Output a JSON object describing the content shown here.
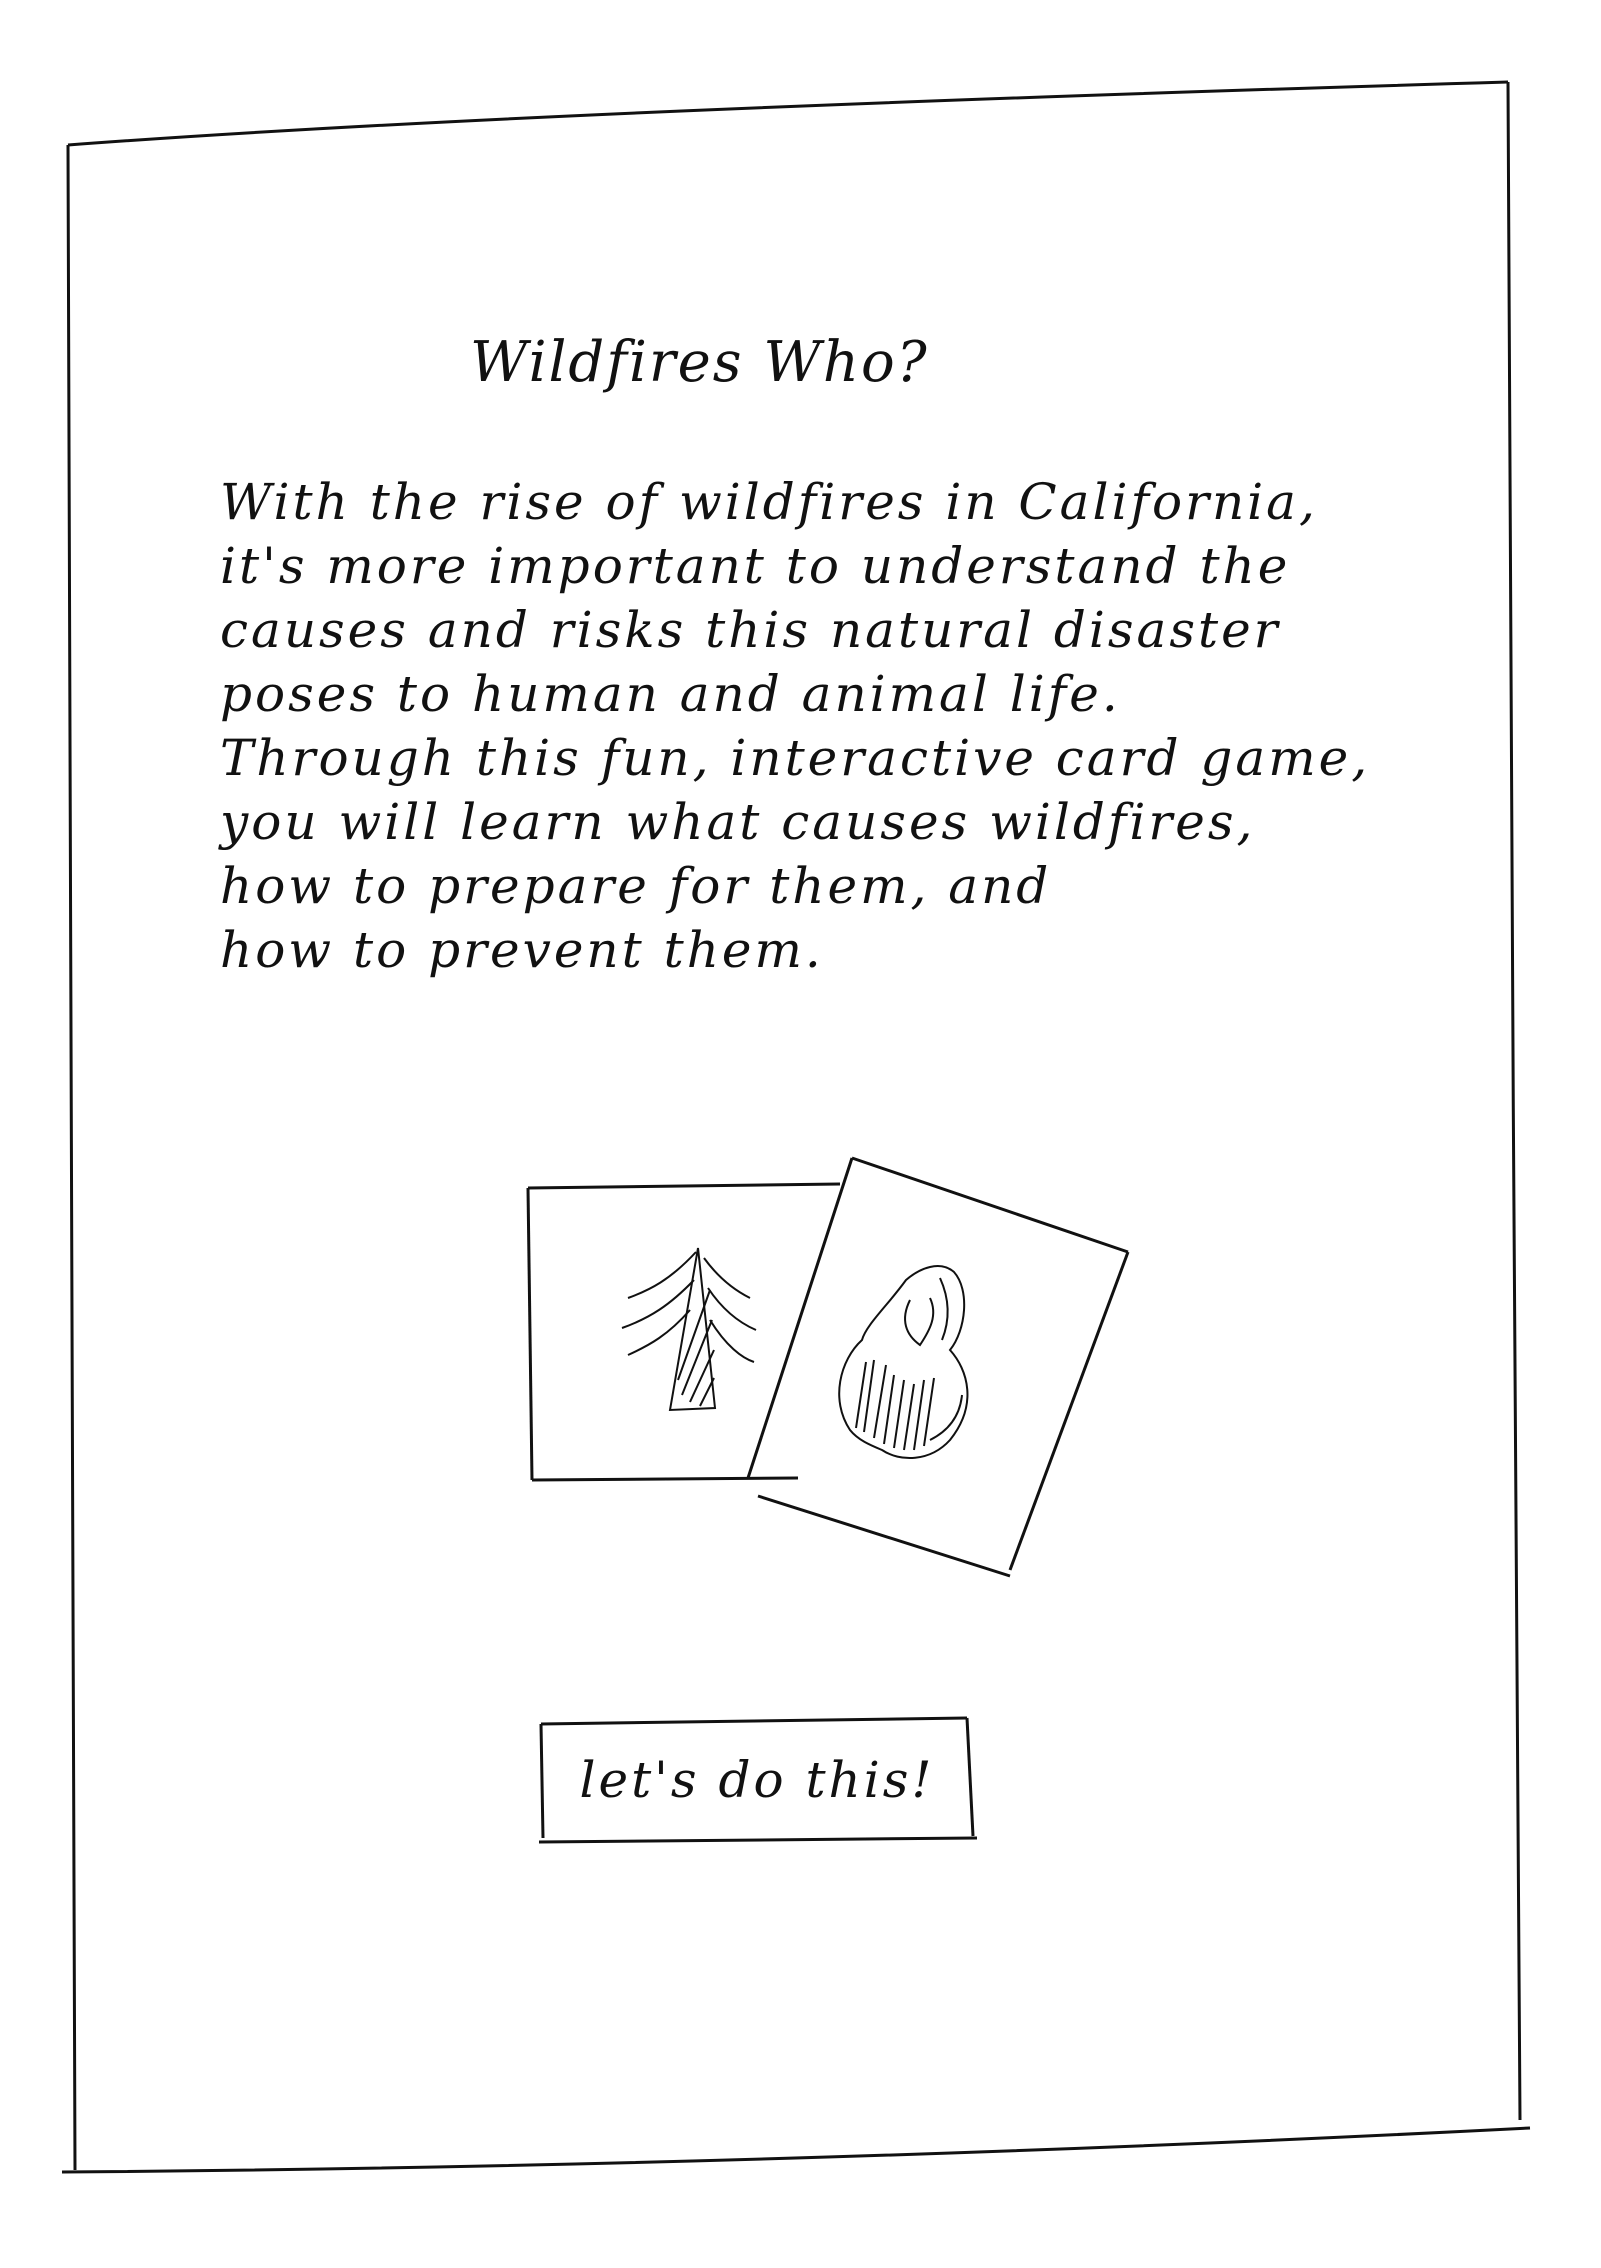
{
  "screen": {
    "title": "Wildfires Who?",
    "intro_lines": [
      "With the rise of wildfires in California,",
      "it's more important to understand the",
      "causes and risks this natural disaster",
      "poses to human and animal life.",
      "Through this fun, interactive card game,",
      "you will learn what causes wildfires,",
      "how to prepare for them, and",
      "how to prevent them."
    ],
    "cards": [
      {
        "icon": "pine-tree-icon"
      },
      {
        "icon": "flame-icon"
      }
    ],
    "cta_label": "let's do this!"
  },
  "colors": {
    "ink": "#111111",
    "paper": "#ffffff"
  }
}
